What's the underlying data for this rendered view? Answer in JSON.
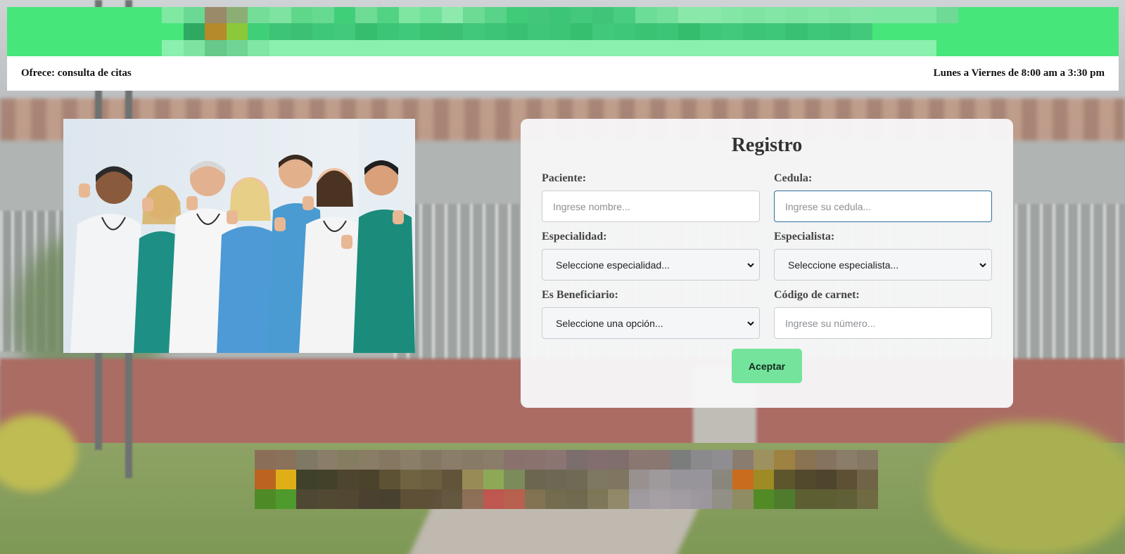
{
  "header": {
    "offer_text": "Ofrece: consulta de citas",
    "schedule_text": "Lunes a Viernes de 8:00 am a 3:30 pm"
  },
  "hero": {
    "image": "doctors-thumbs-up-photo"
  },
  "form": {
    "title": "Registro",
    "paciente": {
      "label": "Paciente:",
      "placeholder": "Ingrese nombre..."
    },
    "cedula": {
      "label": "Cedula:",
      "placeholder": "Ingrese su cedula..."
    },
    "especialidad": {
      "label": "Especialidad:",
      "selected": "Seleccione especialidad..."
    },
    "especialista": {
      "label": "Especialista:",
      "selected": "Seleccione especialista..."
    },
    "beneficiario": {
      "label": "Es Beneficiario:",
      "selected": "Seleccione una opción..."
    },
    "carnet": {
      "label": "Código de carnet:",
      "placeholder": "Ingrese su número..."
    },
    "submit_label": "Aceptar"
  },
  "colors": {
    "banner": "#47e67b",
    "button": "#74e49d",
    "focus_border": "#2f6f9c"
  }
}
